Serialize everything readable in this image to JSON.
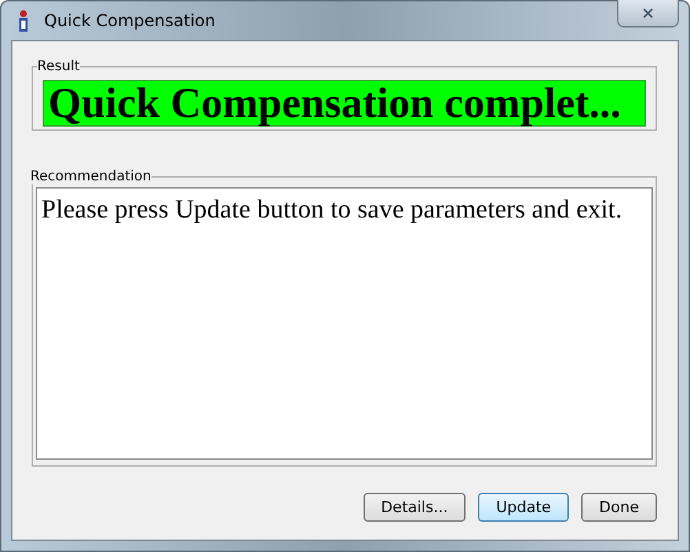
{
  "window": {
    "title": "Quick Compensation",
    "close": "✕"
  },
  "result": {
    "legend": "Result",
    "message": "Quick Compensation complet...",
    "color": "#00ff00"
  },
  "recommendation": {
    "legend": "Recommendation",
    "text": "Please press Update button to save parameters and exit."
  },
  "buttons": [
    {
      "label": "Details...",
      "default": false
    },
    {
      "label": "Update",
      "default": true
    },
    {
      "label": "Done",
      "default": false
    }
  ]
}
